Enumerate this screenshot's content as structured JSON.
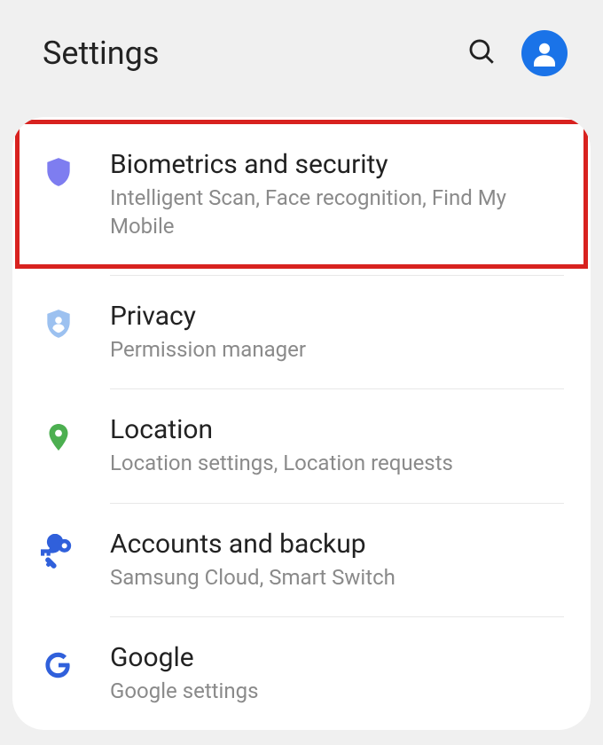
{
  "header": {
    "title": "Settings"
  },
  "items": [
    {
      "title": "Biometrics and security",
      "subtitle": "Intelligent Scan, Face recognition, Find My Mobile",
      "icon": "shield"
    },
    {
      "title": "Privacy",
      "subtitle": "Permission manager",
      "icon": "shield-person"
    },
    {
      "title": "Location",
      "subtitle": "Location settings, Location requests",
      "icon": "pin"
    },
    {
      "title": "Accounts and backup",
      "subtitle": "Samsung Cloud, Smart Switch",
      "icon": "key"
    },
    {
      "title": "Google",
      "subtitle": "Google settings",
      "icon": "google"
    }
  ],
  "colors": {
    "shield_purple": "#7e7df0",
    "shield_blue": "#9cc1f0",
    "pin_green": "#4caf50",
    "key_blue": "#3060db",
    "google_blue": "#3060db",
    "avatar_blue": "#1a73e8",
    "highlight_red": "#d8221f"
  }
}
